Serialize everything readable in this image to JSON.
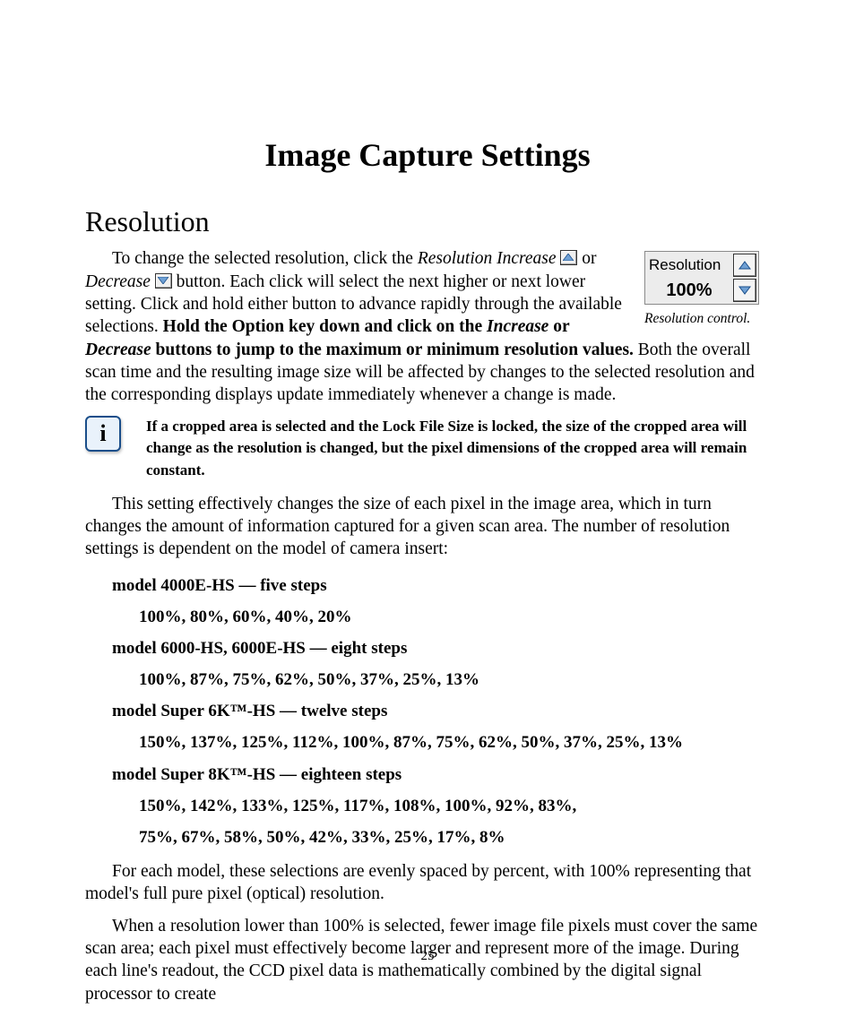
{
  "title": "Image Capture Settings",
  "section": "Resolution",
  "para1": {
    "a": "To change the selected resolution, click the ",
    "b": "Resolution Increase",
    "c": " or ",
    "d": "Decrease",
    "e": " button. Each click will select the next higher or next lower setting. Click and hold either button to advance rapidly through the available selections. ",
    "f": "Hold the Option key down and click on the ",
    "g": "Increase",
    "h": " or ",
    "i": "Decrease",
    "j": " buttons to jump to the maximum or minimum resolution values.",
    "k": " Both the overall scan time and the resulting image size will be affected by changes to the selected resolution and the corresponding displays update immediately whenever a change is made."
  },
  "widget": {
    "label": "Resolution",
    "value": "100%",
    "caption": "Resolution control."
  },
  "note": "If a cropped area is selected and the Lock File Size is locked, the size of the cropped area will change as the resolution is changed, but the pixel dimensions of the cropped area will remain constant.",
  "para2": "This setting effectively changes the size of each pixel in the image area, which in turn changes the amount of information captured for a given scan area.  The number of resolution settings is dependent on the model of camera insert:",
  "models": {
    "m1": {
      "head": "model 4000E-HS — five steps",
      "vals": "100%, 80%, 60%, 40%, 20%"
    },
    "m2": {
      "head": "model 6000-HS, 6000E-HS — eight steps",
      "vals": "100%, 87%, 75%, 62%, 50%, 37%, 25%, 13%"
    },
    "m3": {
      "head": "model Super 6K™-HS — twelve steps",
      "vals": "150%, 137%, 125%, 112%, 100%, 87%, 75%, 62%, 50%, 37%, 25%, 13%"
    },
    "m4": {
      "head": "model Super 8K™-HS — eighteen steps",
      "vals1": "150%, 142%, 133%, 125%, 117%, 108%, 100%, 92%, 83%,",
      "vals2": "75%, 67%, 58%, 50%, 42%, 33%, 25%, 17%, 8%"
    }
  },
  "para3": "For each model, these selections are evenly spaced by percent, with 100% representing that model's full pure pixel (optical) resolution.",
  "para4": "When a resolution lower than 100% is selected, fewer image file pixels must cover the same scan area; each pixel must effectively become larger and represent more of the image. During each line's readout, the CCD pixel data is mathematically combined by the digital signal processor to create",
  "pagenum": "25"
}
